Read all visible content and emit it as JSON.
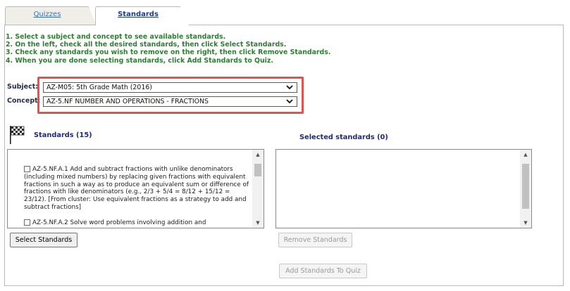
{
  "tabs": [
    {
      "label": "Quizzes"
    },
    {
      "label": "Standards"
    }
  ],
  "instructions": [
    "1. Select a subject and concept to see available standards.",
    "2. On the left, check all the desired standards, then click Select Standards.",
    "3. Check any standards you wish to remove on the right, then click Remove Standards.",
    "4. When you are done selecting standards, click Add Standards to Quiz."
  ],
  "subject": {
    "label": "Subject:",
    "value": "AZ-M05: 5th Grade Math (2016)"
  },
  "concept": {
    "label": "Concept:",
    "value": "AZ-5.NF NUMBER AND OPERATIONS - FRACTIONS"
  },
  "standards_panel": {
    "title": "Standards (15)"
  },
  "selected_panel": {
    "title": "Selected standards (0)"
  },
  "standards": [
    {
      "text": "AZ-5.NF.A.1 Add and subtract fractions with unlike denominators (including mixed numbers) by replacing given fractions with equivalent fractions in such a way as to produce an equivalent sum or difference of fractions with like denominators (e.g., 2/3 + 5/4 = 8/12 + 15/12 = 23/12). [From cluster: Use equivalent fractions as a strategy to add and subtract fractions]",
      "checked": false
    },
    {
      "text": "AZ-5.NF.A.2 Solve word problems involving addition and",
      "checked": false
    }
  ],
  "buttons": {
    "select_standards": "Select Standards",
    "remove_standards": "Remove Standards",
    "add_standards_to_quiz": "Add Standards To Quiz"
  },
  "colors": {
    "instructions": "#2e7d32",
    "highlight": "#e2534f",
    "label": "#1e2a5a"
  }
}
